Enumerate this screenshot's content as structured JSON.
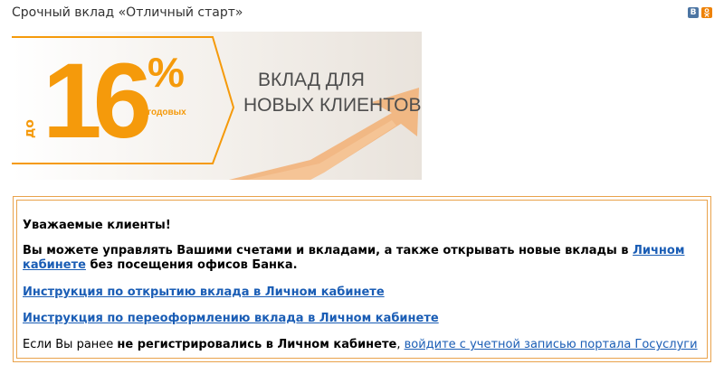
{
  "page_title": "Срочный вклад «Отличный старт»",
  "share": {
    "vk": "В",
    "ok": "ok"
  },
  "banner": {
    "prefix": "до",
    "rate": "16",
    "percent_sign": "%",
    "per_year": "годовых",
    "headline_line1": "ВКЛАД ДЛЯ",
    "headline_line2": "НОВЫХ КЛИЕНТОВ"
  },
  "info": {
    "greeting": "Уважаемые клиенты!",
    "manage_text_before": "Вы можете управлять Вашими счетами и вкладами, а также открывать новые вклады в ",
    "manage_link": "Личном кабинете",
    "manage_text_after": " без посещения офисов Банка.",
    "link_open": "Инструкция по открытию вклада в Личном кабинете",
    "link_renew": "Инструкция по переоформлению вклада в Личном кабинете",
    "last_prefix": "Если Вы ранее ",
    "last_bold": "не регистрировались в Личном кабинете",
    "last_comma": ", ",
    "last_link": "войдите с учетной записью портала Госуслуги"
  },
  "colors": {
    "accent": "#f59a0b",
    "link": "#1a5db5",
    "border": "#e9a24b"
  }
}
